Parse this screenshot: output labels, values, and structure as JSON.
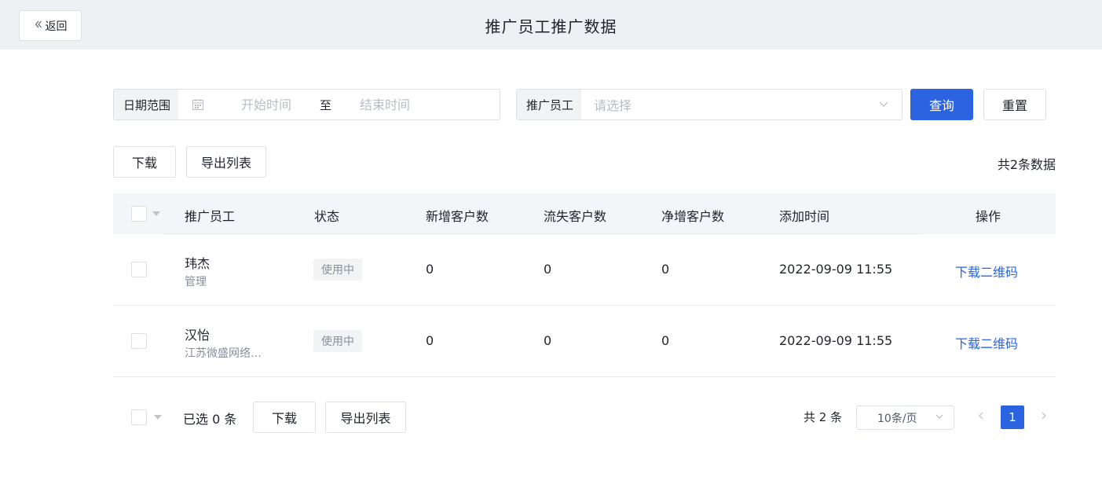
{
  "header": {
    "back_label": "返回",
    "title": "推广员工推广数据"
  },
  "filters": {
    "date_label": "日期范围",
    "start_placeholder": "开始时间",
    "separator": "至",
    "end_placeholder": "结束时间",
    "employee_label": "推广员工",
    "employee_placeholder": "请选择",
    "query_label": "查询",
    "reset_label": "重置"
  },
  "toolbar": {
    "download_label": "下载",
    "export_label": "导出列表",
    "total_text": "共2条数据"
  },
  "table": {
    "columns": [
      "推广员工",
      "状态",
      "新增客户数",
      "流失客户数",
      "净增客户数",
      "添加时间",
      "操作"
    ],
    "rows": [
      {
        "name": "玮杰",
        "sub": "管理",
        "status": "使用中",
        "new_customers": "0",
        "lost_customers": "0",
        "net_customers": "0",
        "added_time": "2022-09-09 11:55",
        "action": "下载二维码"
      },
      {
        "name": "汉怡",
        "sub": "江苏微盛网络…",
        "status": "使用中",
        "new_customers": "0",
        "lost_customers": "0",
        "net_customers": "0",
        "added_time": "2022-09-09 11:55",
        "action": "下载二维码"
      }
    ]
  },
  "footer": {
    "selected_text": "已选 0 条",
    "download_label": "下载",
    "export_label": "导出列表",
    "total_text": "共 2 条",
    "page_size": "10条/页",
    "current_page": "1"
  },
  "colors": {
    "primary": "#2b63e0",
    "header_bg": "#eef0f3"
  }
}
